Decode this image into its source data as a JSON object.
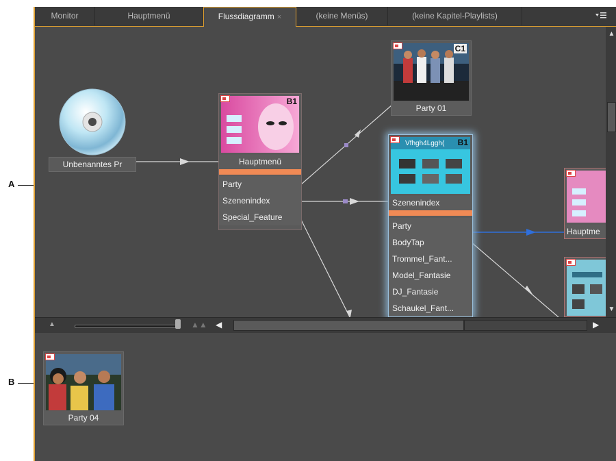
{
  "callouts": {
    "a": "A",
    "b": "B"
  },
  "tabs": [
    {
      "label": "Monitor",
      "active": false
    },
    {
      "label": "Hauptmenü",
      "active": false
    },
    {
      "label": "Flussdiagramm",
      "active": true,
      "close": "×"
    },
    {
      "label": "(keine Menüs)",
      "active": false
    },
    {
      "label": "(keine Kapitel-Playlists)",
      "active": false
    }
  ],
  "panel_menu_icon": "panel-menu-icon",
  "nodes": {
    "disc": {
      "label": "Unbenanntes Pr"
    },
    "hauptmenu": {
      "badge": "B1",
      "title": "Hauptmenü",
      "buttons": [
        "Party",
        "Szenenindex",
        "Special_Feature"
      ]
    },
    "party01": {
      "badge": "C1",
      "title": "Party 01"
    },
    "szenenindex": {
      "badge": "B1",
      "header_text": "Vfhgh4Lggh(",
      "title": "Szenenindex",
      "buttons": [
        "Party",
        "BodyTap",
        "Trommel_Fant...",
        "Model_Fantasie",
        "DJ_Fantasie",
        "Schaukel_Fant..."
      ]
    },
    "hauptmenu_right": {
      "title": "Hauptme"
    },
    "party04": {
      "title": "Party 04"
    }
  },
  "colors": {
    "accent": "#e0a030",
    "menu_bar": "#f08a55",
    "link_white": "#d8d8d8",
    "link_blue": "#2f6fdc",
    "panel_bg": "#4a4a4a"
  },
  "icons": [
    "disc-icon",
    "zoom-out-icon",
    "zoom-in-icon",
    "scroll-left-icon",
    "scroll-right-icon",
    "scroll-up-icon",
    "scroll-down-icon"
  ]
}
